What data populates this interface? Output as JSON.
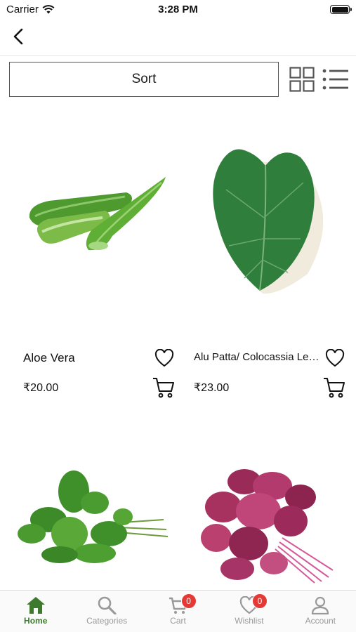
{
  "status_bar": {
    "carrier": "Carrier",
    "time": "3:28 PM"
  },
  "toolbar": {
    "sort_label": "Sort"
  },
  "products": [
    {
      "name": "Aloe Vera",
      "price": "₹20.00",
      "image": "aloe-vera-image"
    },
    {
      "name": "Alu Patta/ Colocassia Leaves",
      "price": "₹23.00",
      "image": "colocasia-leaf-image"
    },
    {
      "name": "",
      "price": "",
      "image": "green-amaranth-image"
    },
    {
      "name": "",
      "price": "",
      "image": "red-amaranth-image"
    }
  ],
  "tab_bar": {
    "items": [
      {
        "label": "Home",
        "icon": "home-icon",
        "active": true
      },
      {
        "label": "Categories",
        "icon": "search-icon"
      },
      {
        "label": "Cart",
        "icon": "cart-icon",
        "badge": "0"
      },
      {
        "label": "Wishlist",
        "icon": "heart-icon",
        "badge": "0"
      },
      {
        "label": "Account",
        "icon": "account-icon"
      }
    ]
  },
  "colors": {
    "accent": "#3e7a2e",
    "badge": "#e53935",
    "inactive": "#999999"
  }
}
